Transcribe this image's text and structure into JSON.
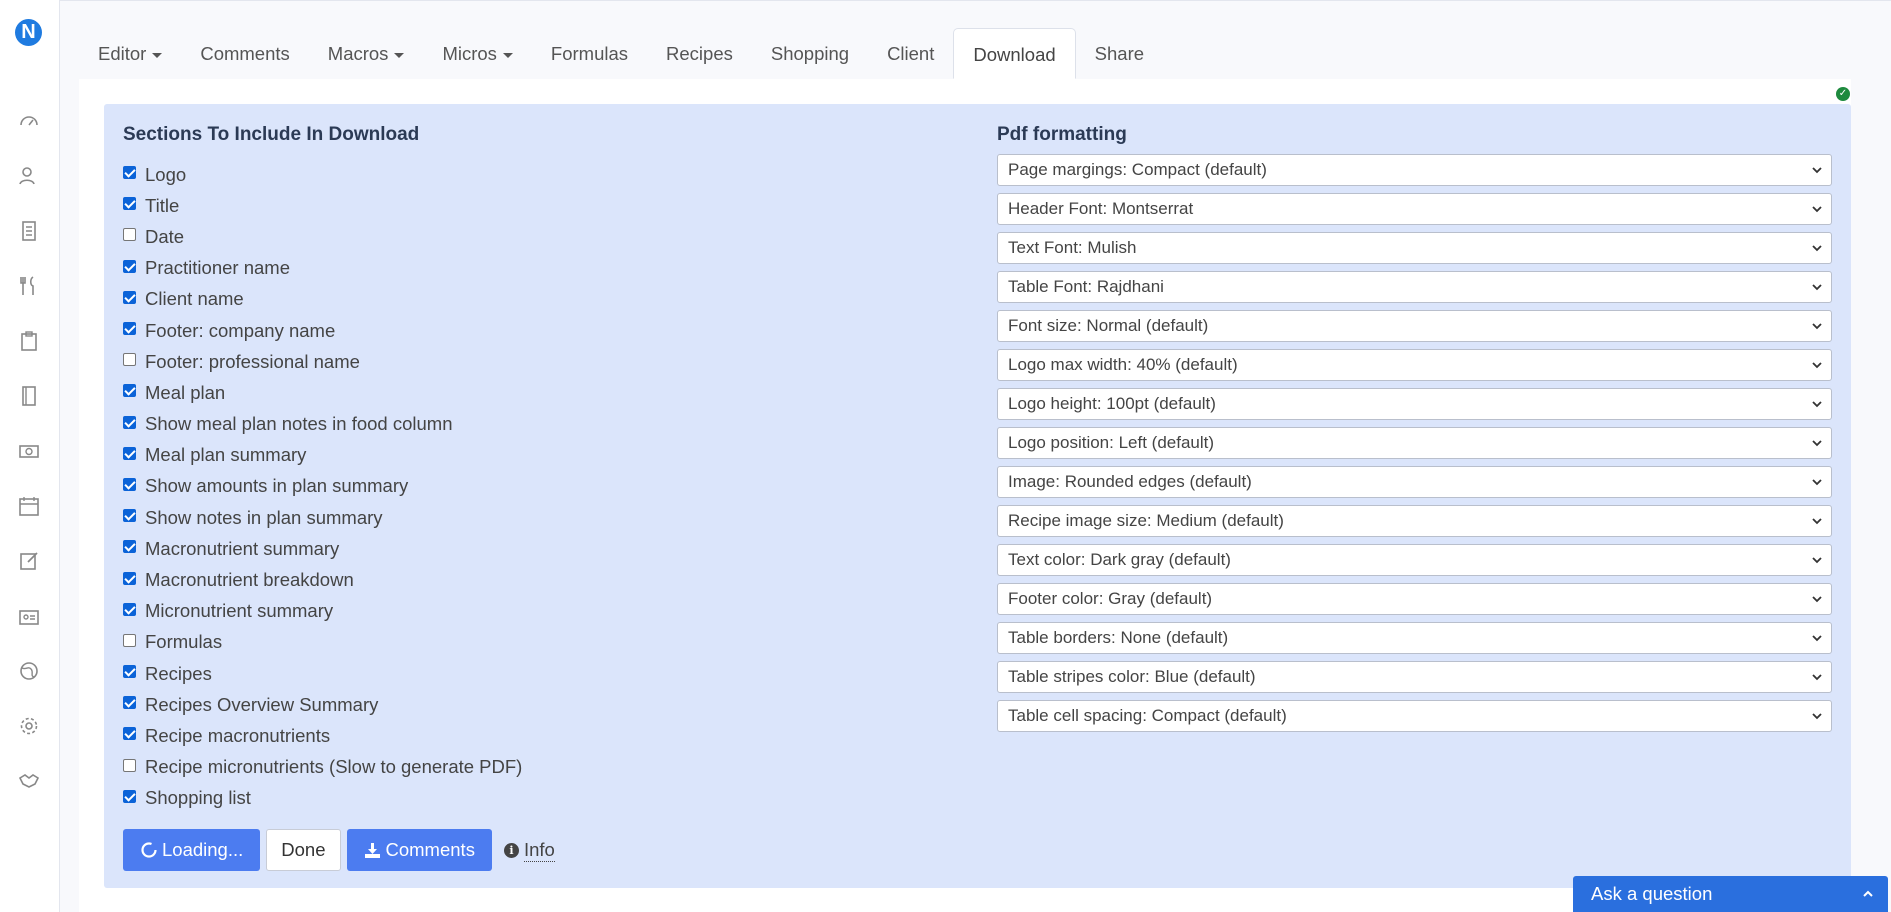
{
  "app": {
    "logo_letter": "N"
  },
  "sidebar": {
    "items": [
      {
        "icon": "dashboard-icon"
      },
      {
        "icon": "clients-icon"
      },
      {
        "icon": "documents-icon"
      },
      {
        "icon": "utensils-icon"
      },
      {
        "icon": "clipboard-icon"
      },
      {
        "icon": "book-icon"
      },
      {
        "icon": "money-icon"
      },
      {
        "icon": "calendar-icon"
      },
      {
        "icon": "edit-icon"
      },
      {
        "icon": "id-card-icon"
      },
      {
        "icon": "globe-icon"
      },
      {
        "icon": "gear-icon"
      },
      {
        "icon": "handshake-icon"
      }
    ]
  },
  "tabs": [
    {
      "label": "Editor",
      "dropdown": true
    },
    {
      "label": "Comments",
      "dropdown": false
    },
    {
      "label": "Macros",
      "dropdown": true
    },
    {
      "label": "Micros",
      "dropdown": true
    },
    {
      "label": "Formulas",
      "dropdown": false
    },
    {
      "label": "Recipes",
      "dropdown": false
    },
    {
      "label": "Shopping",
      "dropdown": false
    },
    {
      "label": "Client",
      "dropdown": false
    },
    {
      "label": "Download",
      "dropdown": false,
      "active": true
    },
    {
      "label": "Share",
      "dropdown": false
    }
  ],
  "sections": {
    "title": "Sections To Include In Download",
    "items": [
      {
        "label": "Logo",
        "checked": true
      },
      {
        "label": "Title",
        "checked": true
      },
      {
        "label": "Date",
        "checked": false
      },
      {
        "label": "Practitioner name",
        "checked": true
      },
      {
        "label": "Client name",
        "checked": true
      },
      {
        "label": "Footer: company name",
        "checked": true
      },
      {
        "label": "Footer: professional name",
        "checked": false
      },
      {
        "label": "Meal plan",
        "checked": true
      },
      {
        "label": "Show meal plan notes in food column",
        "checked": true
      },
      {
        "label": "Meal plan summary",
        "checked": true
      },
      {
        "label": "Show amounts in plan summary",
        "checked": true
      },
      {
        "label": "Show notes in plan summary",
        "checked": true
      },
      {
        "label": "Macronutrient summary",
        "checked": true
      },
      {
        "label": "Macronutrient breakdown",
        "checked": true
      },
      {
        "label": "Micronutrient summary",
        "checked": true
      },
      {
        "label": "Formulas",
        "checked": false
      },
      {
        "label": "Recipes",
        "checked": true
      },
      {
        "label": "Recipes Overview Summary",
        "checked": true
      },
      {
        "label": "Recipe macronutrients",
        "checked": true
      },
      {
        "label": "Recipe micronutrients (Slow to generate PDF)",
        "checked": false
      },
      {
        "label": "Shopping list",
        "checked": true
      }
    ]
  },
  "pdf": {
    "title": "Pdf formatting",
    "options": [
      "Page margings: Compact (default)",
      "Header Font: Montserrat",
      "Text Font: Mulish",
      "Table Font: Rajdhani",
      "Font size: Normal (default)",
      "Logo max width: 40% (default)",
      "Logo height: 100pt (default)",
      "Logo position: Left (default)",
      "Image: Rounded edges (default)",
      "Recipe image size: Medium (default)",
      "Text color: Dark gray (default)",
      "Footer color: Gray (default)",
      "Table borders: None (default)",
      "Table stripes color: Blue (default)",
      "Table cell spacing: Compact (default)"
    ]
  },
  "actions": {
    "loading_label": "Loading...",
    "done_label": "Done",
    "comments_label": "Comments",
    "info_label": "Info"
  },
  "help": {
    "ask_label": "Ask a question"
  },
  "colors": {
    "accent": "#4c7cf0",
    "panel_bg": "#dbe5fb",
    "help_bar": "#2a6fde"
  }
}
